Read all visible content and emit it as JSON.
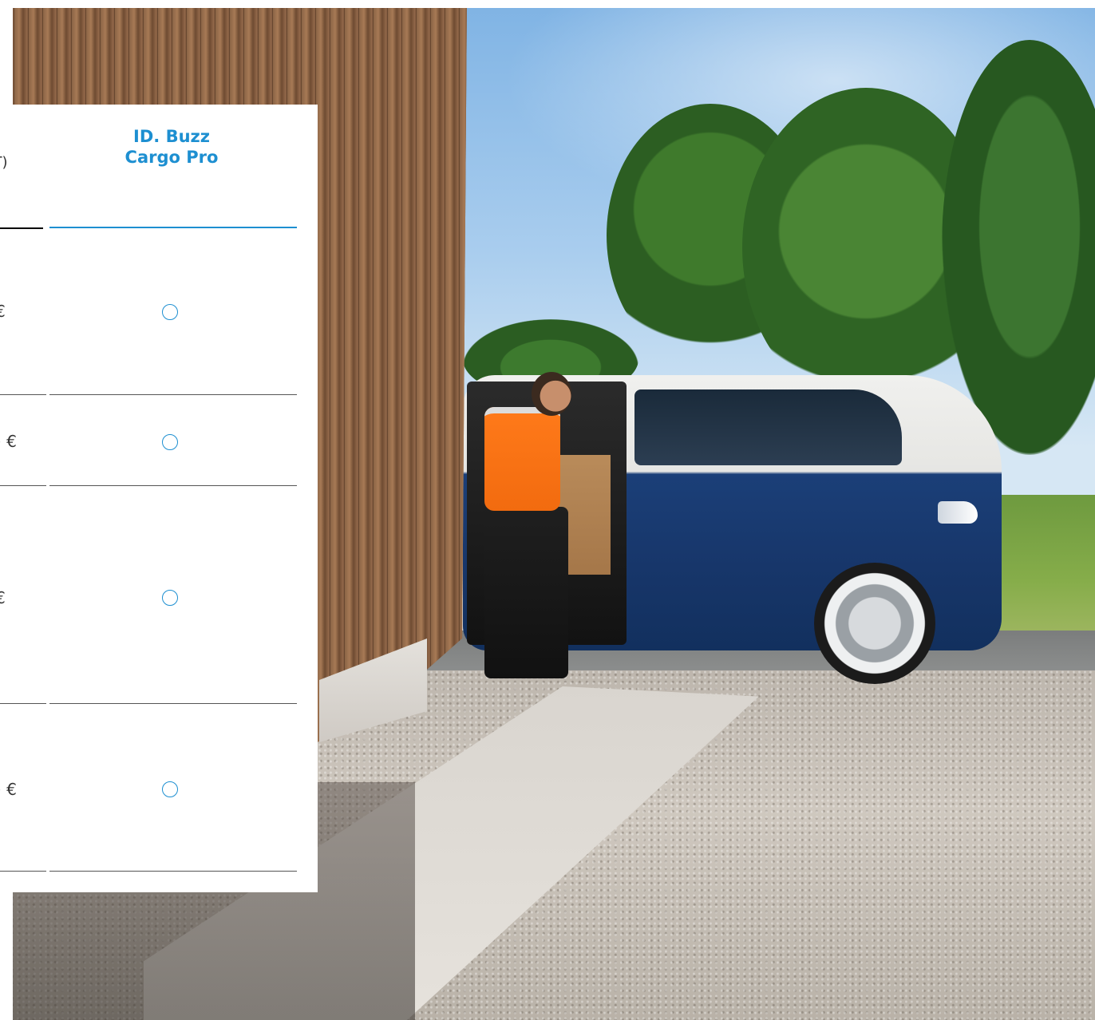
{
  "panel": {
    "left_column_header": "HT)",
    "right_column_header": [
      "ID. Buzz",
      "Cargo Pro"
    ],
    "rows": [
      {
        "price": "€",
        "selected": false
      },
      {
        "price": ") €",
        "selected": false
      },
      {
        "price": "€",
        "selected": false
      },
      {
        "price": ") €",
        "selected": false
      }
    ]
  },
  "colors": {
    "accent": "#1d8fd1",
    "text": "#333333",
    "separator": "#555555"
  },
  "icons": {
    "option": "radio-circle-icon"
  }
}
